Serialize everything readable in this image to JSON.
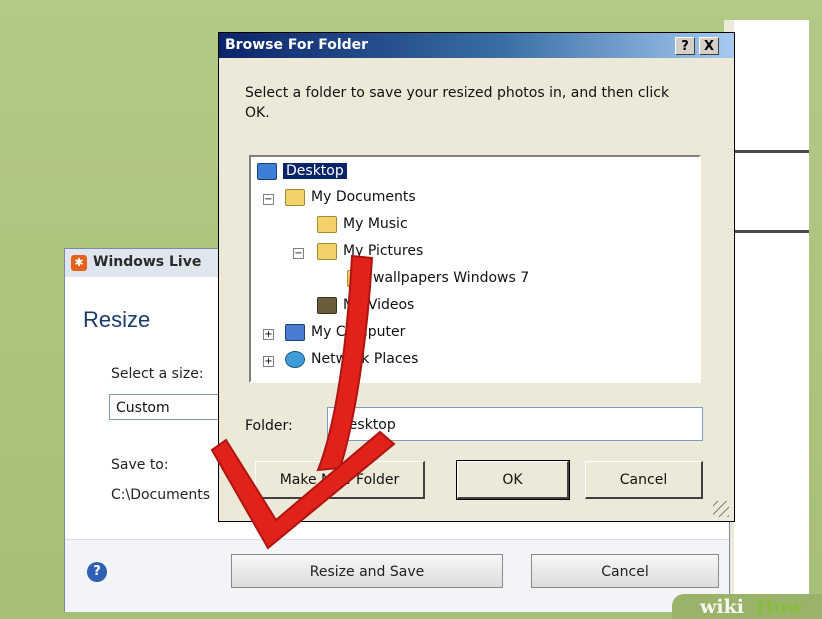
{
  "live_window": {
    "title": "Windows Live",
    "heading": "Resize",
    "select_size_label": "Select a size:",
    "select_size_value": "Custom",
    "save_to_label": "Save to:",
    "save_to_path": "C:\\Documents",
    "buttons": {
      "resize_and_save": "Resize and Save",
      "cancel": "Cancel"
    }
  },
  "browse_dialog": {
    "title": "Browse For Folder",
    "title_buttons": {
      "help": "?",
      "close": "X"
    },
    "instruction": "Select a folder to save your resized photos in, and then click OK.",
    "tree": {
      "desktop": "Desktop",
      "my_documents": "My Documents",
      "my_music": "My Music",
      "my_pictures": "My Pictures",
      "wallpapers": "wallpapers Windows 7",
      "my_videos": "My Videos",
      "my_computer": "My Computer",
      "network_places": "Network Places"
    },
    "folder_label": "Folder:",
    "folder_value": "Desktop",
    "buttons": {
      "new_folder": "Make New Folder",
      "ok": "OK",
      "cancel": "Cancel"
    }
  },
  "watermark": {
    "part1": "wiki",
    "part2": "How"
  },
  "colors": {
    "arrow": "#e0221b",
    "selection": "#0a246a",
    "titlebar": "#0a246a"
  }
}
